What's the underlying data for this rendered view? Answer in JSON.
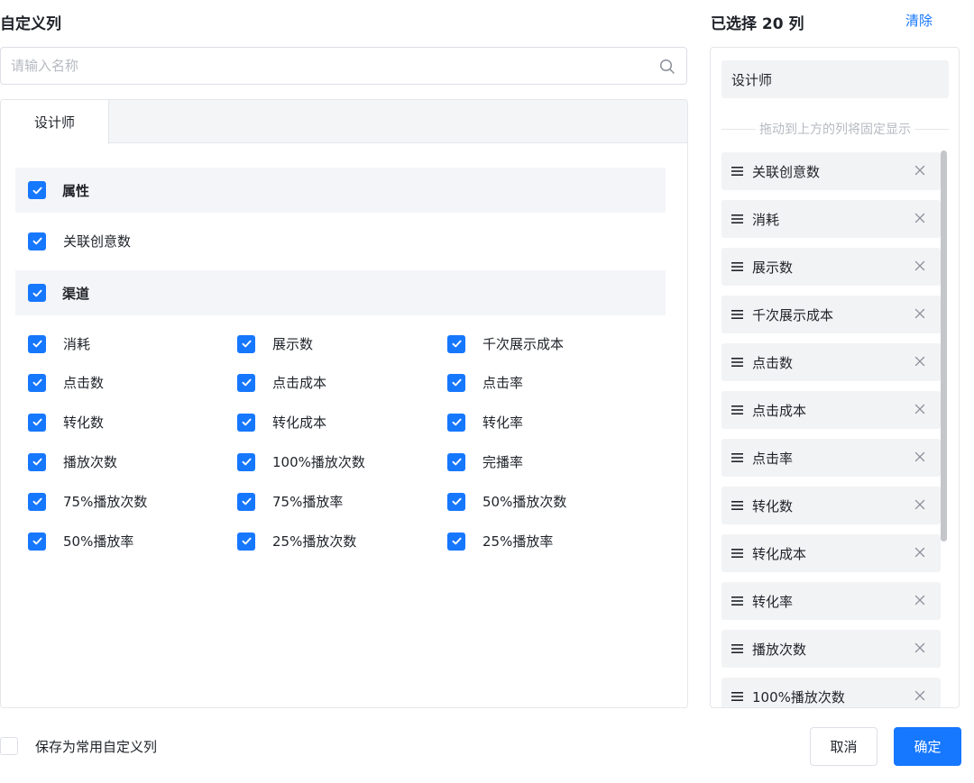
{
  "left": {
    "title": "自定义列",
    "search_placeholder": "请输入名称",
    "tab": "设计师",
    "groups": [
      {
        "label": "属性",
        "checked": true,
        "items": [
          {
            "label": "关联创意数",
            "checked": true
          }
        ]
      },
      {
        "label": "渠道",
        "checked": true,
        "items": [
          {
            "label": "消耗",
            "checked": true
          },
          {
            "label": "展示数",
            "checked": true
          },
          {
            "label": "千次展示成本",
            "checked": true
          },
          {
            "label": "点击数",
            "checked": true
          },
          {
            "label": "点击成本",
            "checked": true
          },
          {
            "label": "点击率",
            "checked": true
          },
          {
            "label": "转化数",
            "checked": true
          },
          {
            "label": "转化成本",
            "checked": true
          },
          {
            "label": "转化率",
            "checked": true
          },
          {
            "label": "播放次数",
            "checked": true
          },
          {
            "label": "100%播放次数",
            "checked": true
          },
          {
            "label": "完播率",
            "checked": true
          },
          {
            "label": "75%播放次数",
            "checked": true
          },
          {
            "label": "75%播放率",
            "checked": true
          },
          {
            "label": "50%播放次数",
            "checked": true
          },
          {
            "label": "50%播放率",
            "checked": true
          },
          {
            "label": "25%播放次数",
            "checked": true
          },
          {
            "label": "25%播放率",
            "checked": true
          }
        ]
      }
    ]
  },
  "right": {
    "title": "已选择 20 列",
    "clear": "清除",
    "fixed_item": "设计师",
    "divider_text": "拖动到上方的列将固定显示",
    "selected": [
      "关联创意数",
      "消耗",
      "展示数",
      "千次展示成本",
      "点击数",
      "点击成本",
      "点击率",
      "转化数",
      "转化成本",
      "转化率",
      "播放次数",
      "100%播放次数"
    ]
  },
  "footer": {
    "save_label": "保存为常用自定义列",
    "save_checked": false,
    "cancel": "取消",
    "confirm": "确定"
  },
  "colors": {
    "accent": "#1677ff",
    "group_bg": "#f4f5f8",
    "item_bg": "#f2f3f5"
  }
}
